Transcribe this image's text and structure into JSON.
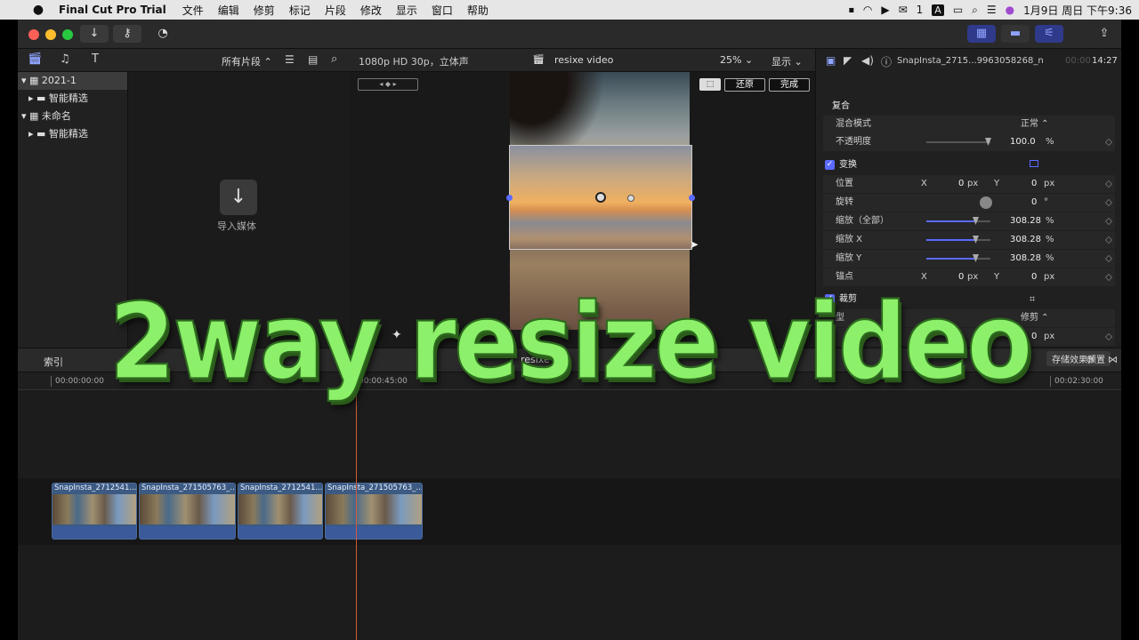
{
  "menubar": {
    "app_name": "Final Cut Pro Trial",
    "items": [
      "文件",
      "编辑",
      "修剪",
      "标记",
      "片段",
      "修改",
      "显示",
      "窗口",
      "帮助"
    ],
    "wechat_count": "1",
    "input_method": "A",
    "datetime": "1月9日 周日 下午9:36"
  },
  "browser": {
    "filter_label": "所有片段 ⌃",
    "import_label": "导入媒体",
    "libraries": [
      {
        "name": "2021-1",
        "smart": "智能精选"
      },
      {
        "name": "未命名",
        "smart": "智能精选"
      }
    ]
  },
  "viewer": {
    "format": "1080p HD 30p，立体声",
    "project_name": "resixe video",
    "zoom": "25% ⌄",
    "display": "显示 ⌄",
    "reset_label": "还原",
    "done_label": "完成"
  },
  "inspector": {
    "clip_name": "SnapInsta_2715...9963058268_n",
    "timecode_dim": "00:00",
    "timecode": "14:27",
    "compositing_title": "复合",
    "blend_mode_label": "混合模式",
    "blend_mode_value": "正常 ⌃",
    "opacity_label": "不透明度",
    "opacity_value": "100.0",
    "percent": "%",
    "transform_title": "变换",
    "position_label": "位置",
    "x": "X",
    "y": "Y",
    "px": "px",
    "position_x": "0",
    "position_y": "0",
    "rotation_label": "旋转",
    "rotation_value": "0",
    "degree": "°",
    "scale_all_label": "缩放（全部）",
    "scale_all_value": "308.28",
    "scale_x_label": "缩放 X",
    "scale_x_value": "308.28",
    "scale_y_label": "缩放 Y",
    "scale_y_value": "308.28",
    "anchor_label": "锚点",
    "anchor_x": "0",
    "anchor_y": "0",
    "crop_title": "裁剪",
    "crop_type_label": "型",
    "crop_type_value": "修剪 ⌃",
    "crop_px_value": "0",
    "save_preset_label": "存储效果预置"
  },
  "timeline": {
    "index_label": "索引",
    "project_label": "resixe ⌄",
    "ticks": [
      "00:00:00:00",
      "00:00:45:00",
      "00:02:30:00"
    ],
    "clips": [
      {
        "name": "SnapInsta_2712541..."
      },
      {
        "name": "SnapInsta_271505763_..."
      },
      {
        "name": "SnapInsta_2712541..."
      },
      {
        "name": "SnapInsta_271505763_..."
      }
    ]
  },
  "overlay_title": "2way resize video",
  "colors": {
    "accent": "#5b6bff",
    "overlay_green": "#8cf06a",
    "clip_blue": "#3c5a82",
    "playhead": "#d05a3a"
  }
}
